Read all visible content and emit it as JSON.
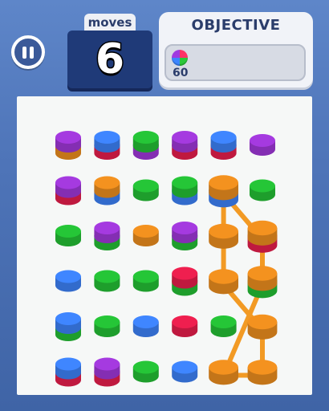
{
  "hud": {
    "moves_label": "moves",
    "moves_value": "6",
    "objective_title": "OBJECTIVE",
    "objective_count": "60",
    "objective_icon": "multicolor-ball-icon"
  },
  "colors": {
    "purple": "#a53ae0",
    "blue": "#3f86ff",
    "green": "#25c637",
    "orange": "#f4921f",
    "red": "#ef1f4f",
    "connector": "#f29a24"
  },
  "board": {
    "cols": 6,
    "rows": 6,
    "cells": [
      [
        [
          "purple",
          "orange"
        ],
        [
          "blue",
          "red"
        ],
        [
          "green",
          "purple"
        ],
        [
          "purple",
          "red"
        ],
        [
          "blue",
          "red"
        ],
        [
          "purple"
        ]
      ],
      [
        [
          "purple",
          "red"
        ],
        [
          "orange",
          "blue"
        ],
        [
          "green"
        ],
        [
          "green",
          "blue"
        ],
        [
          "orange",
          "blue"
        ],
        [
          "green"
        ]
      ],
      [
        [
          "green"
        ],
        [
          "purple",
          "green"
        ],
        [
          "orange"
        ],
        [
          "purple",
          "green"
        ],
        [
          "orange"
        ],
        [
          "orange",
          "red"
        ]
      ],
      [
        [
          "blue"
        ],
        [
          "green"
        ],
        [
          "green"
        ],
        [
          "red",
          "green"
        ],
        [
          "orange"
        ],
        [
          "orange",
          "green"
        ]
      ],
      [
        [
          "blue",
          "green"
        ],
        [
          "green"
        ],
        [
          "blue"
        ],
        [
          "red"
        ],
        [
          "green"
        ],
        [
          "orange"
        ]
      ],
      [
        [
          "blue",
          "red"
        ],
        [
          "purple",
          "red"
        ],
        [
          "green"
        ],
        [
          "blue"
        ],
        [
          "orange"
        ],
        [
          "orange"
        ]
      ]
    ],
    "selected_path": [
      [
        1,
        4
      ],
      [
        2,
        4
      ],
      [
        3,
        4
      ],
      [
        4,
        5
      ],
      [
        5,
        5
      ],
      [
        5,
        4
      ],
      [
        3,
        5
      ],
      [
        2,
        5
      ],
      [
        1,
        4
      ]
    ]
  }
}
